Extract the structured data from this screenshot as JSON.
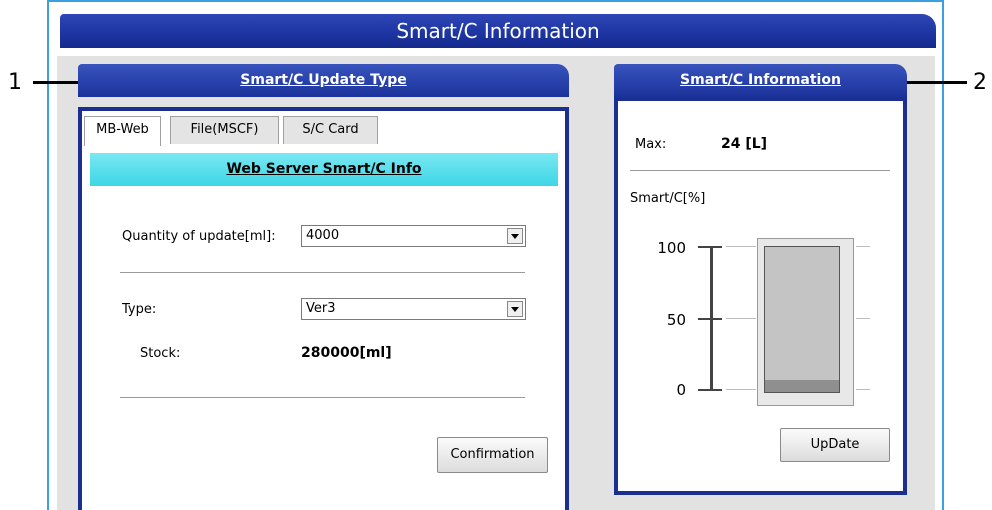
{
  "window": {
    "title": "Smart/C Information"
  },
  "callouts": {
    "left": "1",
    "right": "2"
  },
  "update_section": {
    "header": "Smart/C Update Type",
    "tabs": [
      {
        "label": "MB-Web",
        "active": true
      },
      {
        "label": "File(MSCF)",
        "active": false
      },
      {
        "label": "S/C Card",
        "active": false
      }
    ],
    "banner": "Web Server Smart/C Info",
    "quantity": {
      "label": "Quantity of update[ml]:",
      "value": "4000"
    },
    "type": {
      "label": "Type:",
      "value": "Ver3"
    },
    "stock": {
      "label": "Stock:",
      "value": "280000[ml]"
    },
    "confirm_label": "Confirmation"
  },
  "info_section": {
    "header": "Smart/C Information",
    "max": {
      "label": "Max:",
      "value": "24 [L]"
    },
    "gauge": {
      "label": "Smart/C[%]",
      "ticks": [
        "100",
        "50",
        "0"
      ],
      "level_percent": 8
    },
    "update_label": "UpDate"
  },
  "colors": {
    "title_bar": "#1e36a3",
    "banner": "#3dd6e6",
    "panel_border": "#1a2f8f"
  }
}
